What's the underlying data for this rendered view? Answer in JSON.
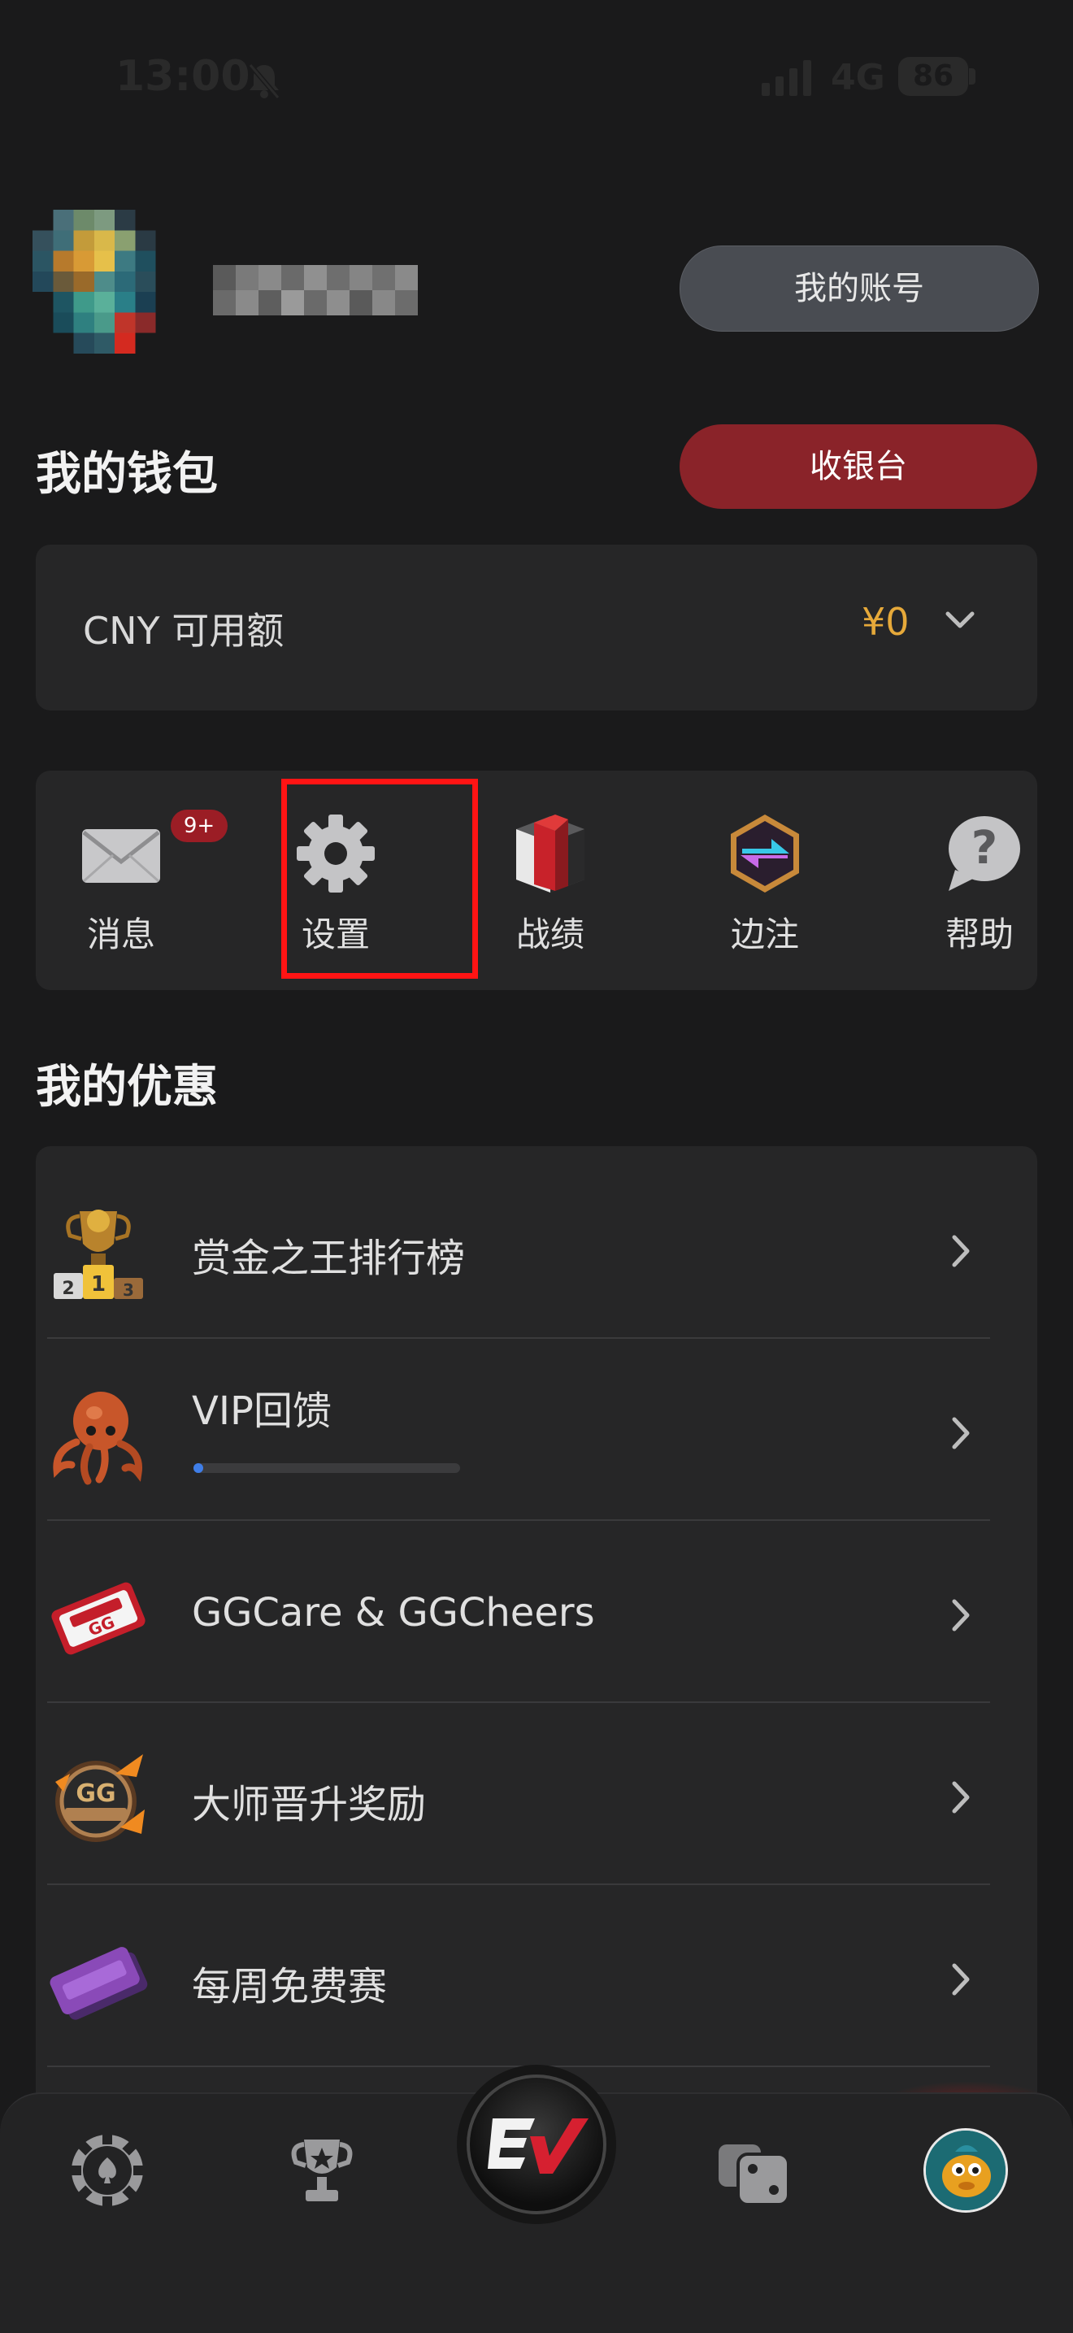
{
  "status_bar": {
    "time": "13:00",
    "network": "4G",
    "battery": "86"
  },
  "profile": {
    "account_button": "我的账号"
  },
  "wallet": {
    "title": "我的钱包",
    "cashier_button": "收银台",
    "balance_label": "CNY 可用额",
    "balance_value": "¥0",
    "colors": {
      "balance": "#e6a93a",
      "cashier_bg": "#8a2329"
    }
  },
  "quick_actions": [
    {
      "label": "消息",
      "icon": "mail-icon",
      "badge": "9+"
    },
    {
      "label": "设置",
      "icon": "gear-icon",
      "highlighted": true
    },
    {
      "label": "战绩",
      "icon": "stats-cube-icon"
    },
    {
      "label": "边注",
      "icon": "side-bet-icon"
    },
    {
      "label": "帮助",
      "icon": "help-icon"
    }
  ],
  "offers": {
    "title": "我的优惠",
    "items": [
      {
        "label": "赏金之王排行榜",
        "icon": "trophy-podium-icon"
      },
      {
        "label": "VIP回馈",
        "icon": "octopus-icon",
        "progress": 0.02
      },
      {
        "label": "GGCare & GGCheers",
        "icon": "ggcheers-ticket-icon"
      },
      {
        "label": "大师晋升奖励",
        "icon": "gg-masters-badge-icon"
      },
      {
        "label": "每周免费赛",
        "icon": "free-tournament-ticket-icon"
      }
    ]
  },
  "bottom_nav": [
    {
      "name": "poker-chip-icon"
    },
    {
      "name": "tournament-trophy-icon"
    },
    {
      "name": "ev-logo-icon"
    },
    {
      "name": "dice-icon"
    },
    {
      "name": "profile-avatar-icon"
    }
  ]
}
